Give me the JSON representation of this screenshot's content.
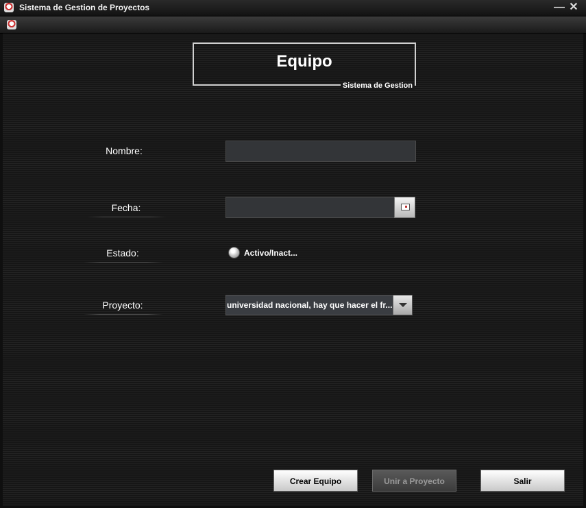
{
  "window": {
    "title": "Sistema de Gestion de Proyectos",
    "minimize_glyph": "—",
    "close_glyph": "✕",
    "app_icon": "java-cup-icon"
  },
  "header": {
    "title": "Equipo",
    "subtitle": "Sistema de Gestion"
  },
  "form": {
    "nombre_label": "Nombre:",
    "nombre_value": "",
    "fecha_label": "Fecha:",
    "fecha_value": "",
    "estado_label": "Estado:",
    "estado_option": "Activo/Inact...",
    "estado_checked": false,
    "proyecto_label": "Proyecto:",
    "proyecto_selected": "universidad nacional, hay que hacer el fr..."
  },
  "buttons": {
    "crear": "Crear Equipo",
    "unir": "Unir a Proyecto",
    "salir": "Salir"
  }
}
